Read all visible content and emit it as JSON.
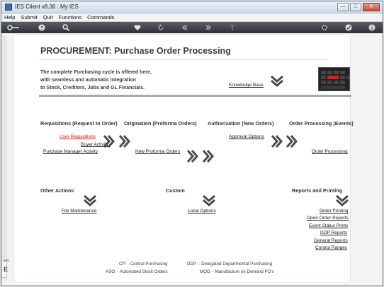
{
  "window": {
    "title": "IES Client v8.36 : My IES",
    "buttons": {
      "minimize": "—",
      "maximize": "□",
      "close": "X"
    }
  },
  "menubar": {
    "items": [
      "Help",
      "Submit",
      "Quit",
      "Functions",
      "Commands"
    ]
  },
  "toolbar": {
    "icons": [
      "key-icon",
      "help-icon",
      "search-icon",
      "heart-icon",
      "refresh-icon",
      "rewind-icon",
      "fast-forward-icon",
      "upload-icon",
      "settings-icon",
      "checkmark-icon",
      "info-icon"
    ]
  },
  "side_tab": {
    "line1": "Ses",
    "line2": "E"
  },
  "page": {
    "title": "PROCUREMENT: Purchase Order Processing",
    "intro_lines": [
      "The complete Purchasing cycle is offered here,",
      "with seamless and automatic integration",
      "to Stock, Creditors, Jobs and GL Financials."
    ],
    "knowledge_base": "Knowledge Base"
  },
  "sections": {
    "requisitions": {
      "title": "Requisitions (Request to Order)",
      "links": [
        "User Requisitions",
        "Buyer Activity",
        "Purchase Manager Activity"
      ]
    },
    "origination": {
      "title": "Origination (Proforma Orders)",
      "links": [
        "New Proforma Orders"
      ]
    },
    "authorization": {
      "title": "Authorization (New Orders)",
      "links": [
        "Approval Options"
      ]
    },
    "order_processing": {
      "title": "Order Processing (Events)",
      "links": [
        "Order Processing"
      ]
    },
    "other_actions": {
      "title": "Other Actions",
      "links": [
        "File Maintenance"
      ]
    },
    "custom": {
      "title": "Custom",
      "links": [
        "Local Options"
      ]
    },
    "reports": {
      "title": "Reports and Printing",
      "links": [
        "Order Printing",
        "Open Order Reports",
        "Event Status Prints",
        "DDP Reports",
        "General Reports",
        "Control Ranges"
      ]
    }
  },
  "legend": {
    "cp": "CP: - Central Purchasing",
    "aso": "ASO: - Automated Stock Orders",
    "ddp": "DDP: - Delegated Departmental Purchasing",
    "mod": "MOD: - Manufacture on Demand PO's"
  },
  "colors": {
    "active_link": "#d01818",
    "arrow": "#4a4a4a"
  }
}
